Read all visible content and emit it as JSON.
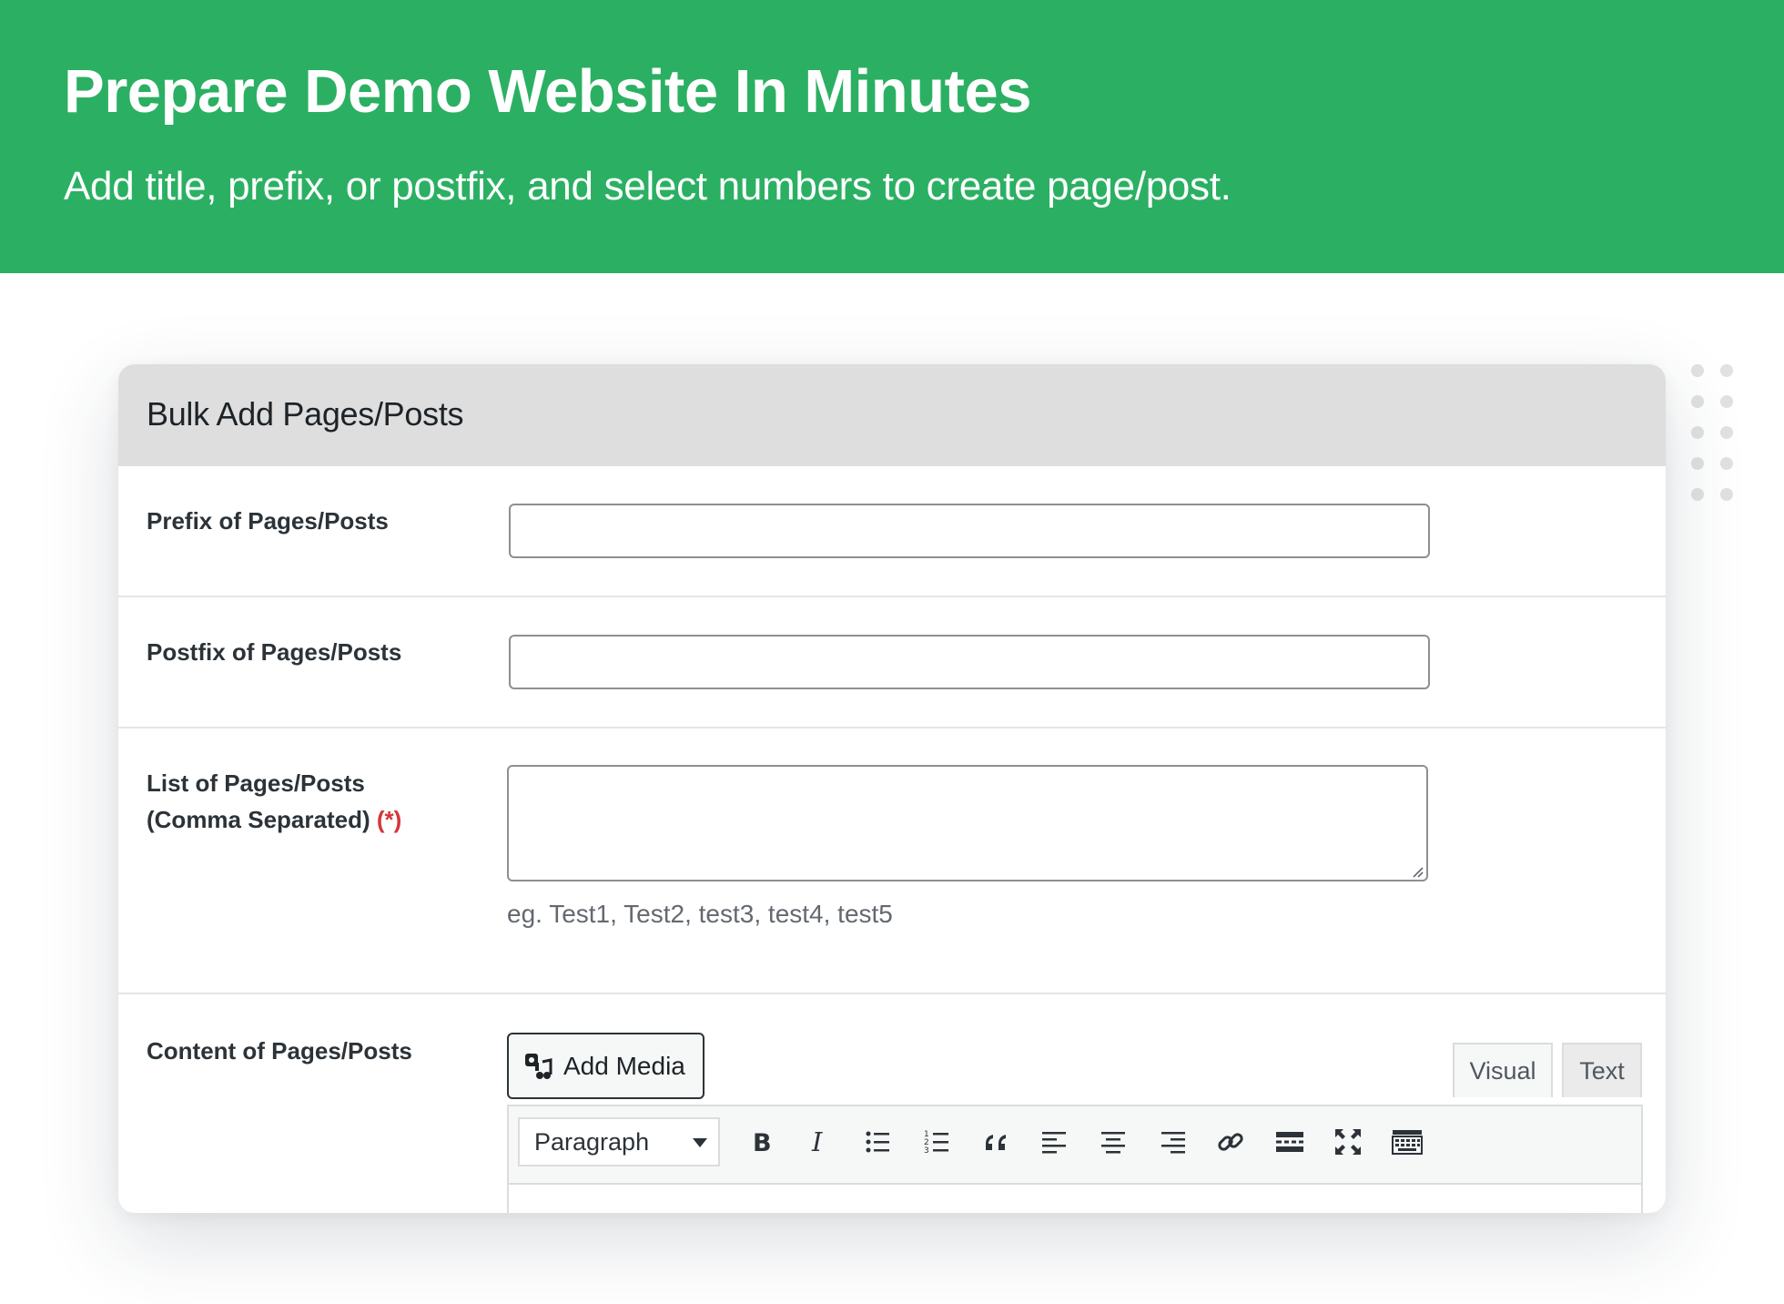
{
  "banner": {
    "title": "Prepare Demo Website In Minutes",
    "subtitle": "Add title, prefix, or postfix, and select numbers to create page/post."
  },
  "card": {
    "title": "Bulk Add Pages/Posts",
    "prefix": {
      "label": "Prefix of Pages/Posts",
      "value": ""
    },
    "postfix": {
      "label": "Postfix of Pages/Posts",
      "value": ""
    },
    "list": {
      "label_line1": "List of Pages/Posts",
      "label_line2": "(Comma Separated)",
      "required_marker": "(*)",
      "value": "",
      "hint": "eg. Test1, Test2, test3, test4, test5"
    },
    "content": {
      "label": "Content of Pages/Posts",
      "add_media_label": "Add Media",
      "tabs": [
        "Visual",
        "Text"
      ],
      "format_selected": "Paragraph",
      "toolbar_icons": [
        "bold-icon",
        "italic-icon",
        "bullet-list-icon",
        "numbered-list-icon",
        "blockquote-icon",
        "align-left-icon",
        "align-center-icon",
        "align-right-icon",
        "link-icon",
        "read-more-icon",
        "fullscreen-icon",
        "toolbar-toggle-icon"
      ]
    }
  },
  "colors": {
    "banner": "#2bb063",
    "card_header": "#dedede",
    "required": "#d63638",
    "hint_text": "#646970"
  }
}
